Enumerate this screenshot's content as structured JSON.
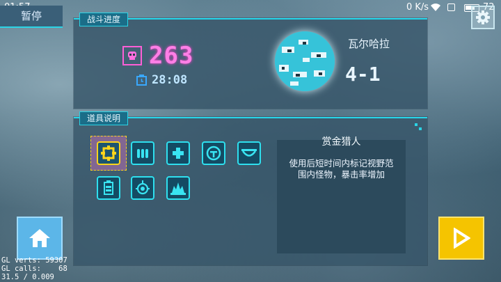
{
  "status_bar": {
    "time": "01:57",
    "network_speed": "0 K/s",
    "battery": "72"
  },
  "top": {
    "pause_label": "暂停",
    "settings_icon": "gear-icon"
  },
  "progress_panel": {
    "title": "战斗进度",
    "score": "263",
    "timer": "28:08",
    "planet_name": "瓦尔哈拉",
    "stage": "4-1"
  },
  "items_panel": {
    "title": "道具说明",
    "items": [
      {
        "icon": "crosshair-icon",
        "selected": true
      },
      {
        "icon": "ammo-icon",
        "selected": false
      },
      {
        "icon": "health-cross-icon",
        "selected": false
      },
      {
        "icon": "target-icon",
        "selected": false
      },
      {
        "icon": "bridge-icon",
        "selected": false
      },
      {
        "icon": "battery-icon",
        "selected": false
      },
      {
        "icon": "radar-icon",
        "selected": false
      },
      {
        "icon": "blast-icon",
        "selected": false
      }
    ],
    "selected_name": "赏金猎人",
    "selected_description": "使用后短时间内标记视野范围内怪物，暴击率增加"
  },
  "debug": {
    "gl_verts": "GL verts: 59307",
    "gl_calls": "GL calls:    68",
    "fps": "31.5 / 0.009"
  },
  "colors": {
    "accent_cyan": "#27d6ea",
    "score_pink": "#ff7fe6",
    "selected_yellow": "#ffd51a",
    "home_blue": "#5cb6e8",
    "play_yellow": "#f5c400"
  }
}
